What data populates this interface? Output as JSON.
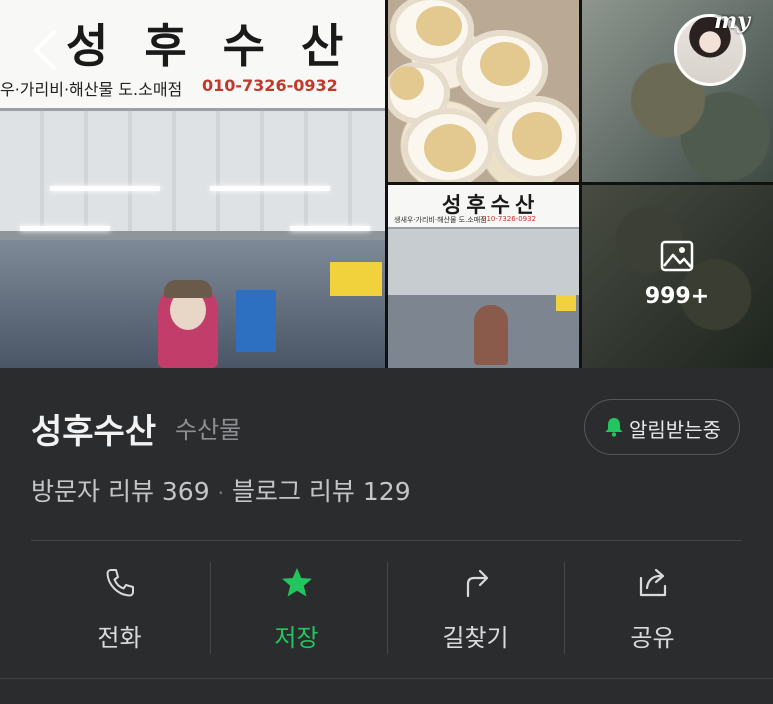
{
  "photos": {
    "main_sign_title": "성 후 수 산",
    "main_sign_subtitle": "우·가리비·해산물 도.소매점",
    "main_sign_phone": "010-7326-0932",
    "store2_sign_title": "성후수산",
    "store2_sign_subtitle": "생새우·가리비·해산물 도.소매점",
    "store2_sign_phone": "010-7326-0932",
    "my_badge_label": "my",
    "more_count": "999+"
  },
  "place": {
    "name": "성후수산",
    "category": "수산물",
    "alarm_label": "알림받는중",
    "visitor_reviews": "방문자 리뷰 369",
    "separator": "·",
    "blog_reviews": "블로그 리뷰 129"
  },
  "actions": [
    {
      "label": "전화",
      "icon": "phone-icon"
    },
    {
      "label": "저장",
      "icon": "star-icon"
    },
    {
      "label": "길찾기",
      "icon": "directions-icon"
    },
    {
      "label": "공유",
      "icon": "share-icon"
    }
  ],
  "colors": {
    "background": "#2b2c2e",
    "accent_green": "#22c55e",
    "muted_text": "#8e8f93"
  }
}
